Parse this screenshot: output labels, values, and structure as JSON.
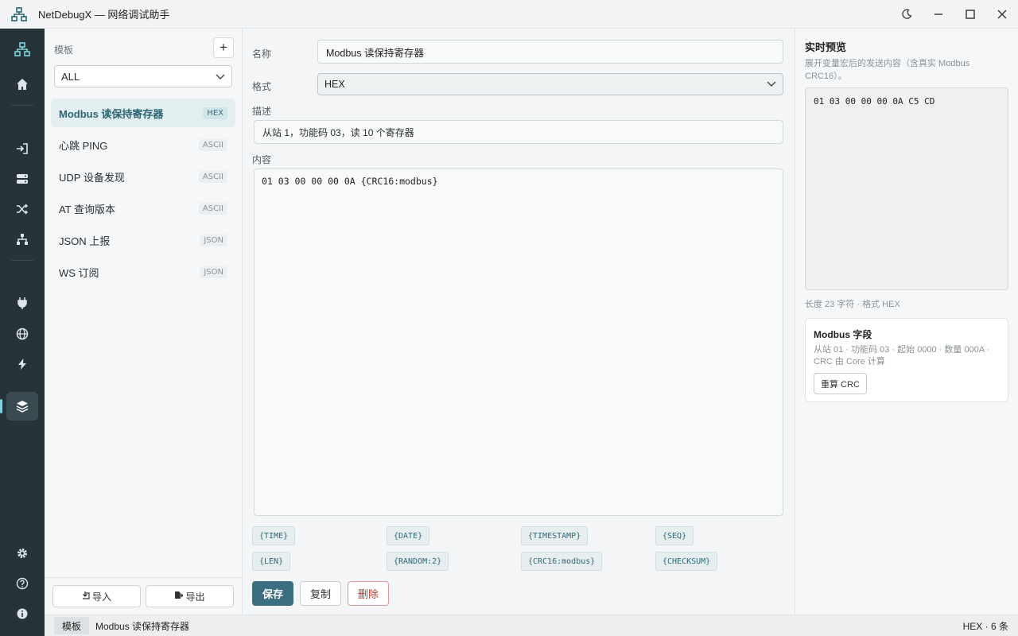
{
  "app": {
    "title": "NetDebugX — 网络调试助手"
  },
  "list": {
    "heading": "模板",
    "add_label": "+",
    "filter_value": "ALL",
    "items": [
      {
        "name": "Modbus 读保持寄存器",
        "badge": "HEX"
      },
      {
        "name": "心跳 PING",
        "badge": "ASCII"
      },
      {
        "name": "UDP 设备发现",
        "badge": "ASCII"
      },
      {
        "name": "AT 查询版本",
        "badge": "ASCII"
      },
      {
        "name": "JSON 上报",
        "badge": "JSON"
      },
      {
        "name": "WS 订阅",
        "badge": "JSON"
      }
    ],
    "import_label": "导入",
    "export_label": "导出"
  },
  "editor": {
    "name_label": "名称",
    "name_value": "Modbus 读保持寄存器",
    "format_label": "格式",
    "format_value": "HEX",
    "desc_label": "描述",
    "desc_value": "从站 1，功能码 03，读 10 个寄存器",
    "content_label": "内容",
    "content_value": "01 03 00 00 00 0A {CRC16:modbus}",
    "macros": [
      "{TIME}",
      "{DATE}",
      "{TIMESTAMP}",
      "{SEQ}",
      "{LEN}",
      "{RANDOM:2}",
      "{CRC16:modbus}",
      "{CHECKSUM}"
    ],
    "save_label": "保存",
    "copy_label": "复制",
    "delete_label": "删除"
  },
  "preview": {
    "title": "实时预览",
    "desc": "展开变量宏后的发送内容（含真实 Modbus CRC16）。",
    "output": "01 03 00 00 00 0A C5 CD",
    "meta": "长度 23 字符 · 格式 HEX",
    "card_title": "Modbus 字段",
    "card_text": "从站 01 · 功能码 03 · 起始 0000 · 数量 000A · CRC 由 Core 计算",
    "card_button": "重算 CRC"
  },
  "status": {
    "chip": "模板",
    "current": "Modbus 读保持寄存器",
    "right": "HEX · 6 条"
  },
  "icons": {
    "logo": "network-icon",
    "theme": "moon-icon",
    "rail": [
      "topology-icon",
      "home-icon",
      "login-icon",
      "server-icon",
      "shuffle-icon",
      "sitemap-icon",
      "plug-icon",
      "globe-icon",
      "bolt-icon",
      "layers-icon",
      "gear-icon",
      "help-icon",
      "info-icon"
    ]
  },
  "colors": {
    "accent": "#3b6f80",
    "rail_bg": "#263338",
    "danger": "#c0392b",
    "active_indicator": "#7fd3df"
  }
}
